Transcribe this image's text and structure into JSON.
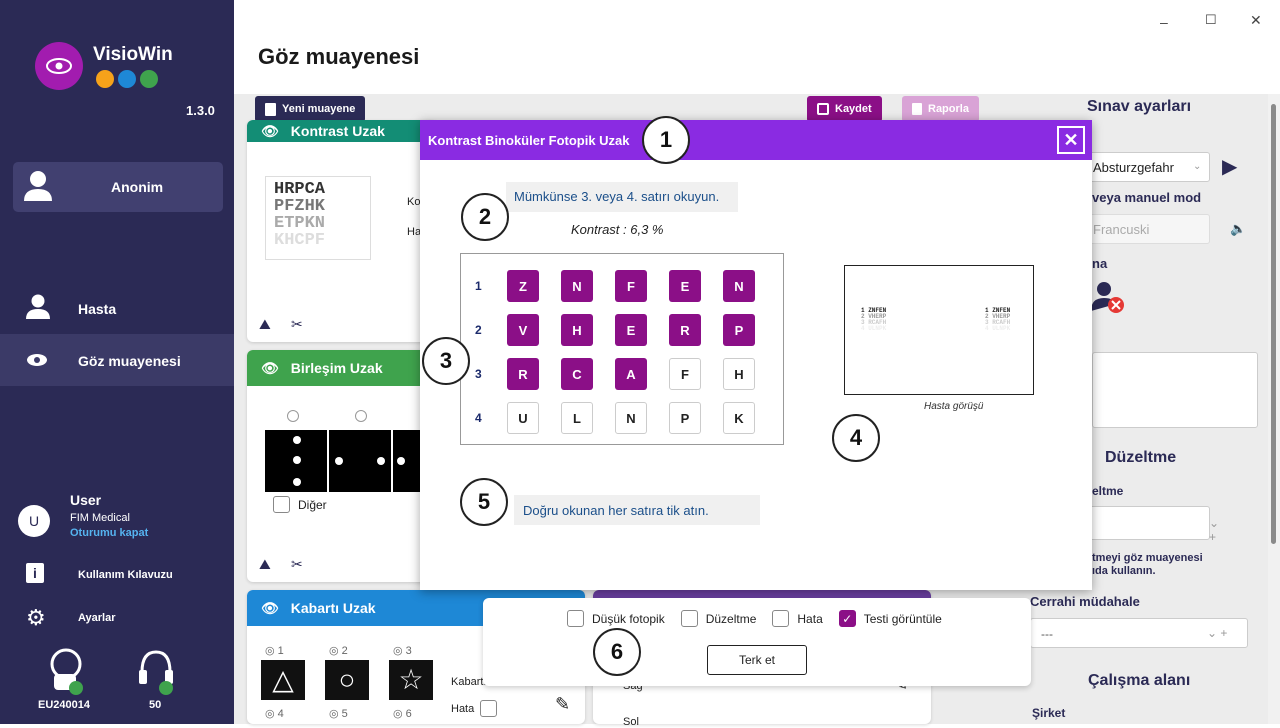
{
  "app": {
    "name": "VisioWin",
    "version": "1.3.0"
  },
  "window": {
    "minimize": "–",
    "maximize": "☐",
    "close": "✕"
  },
  "sidebar": {
    "patient": "Anonim",
    "items": [
      {
        "label": "Hasta"
      },
      {
        "label": "Göz muayenesi"
      }
    ],
    "user": {
      "initial": "U",
      "name": "User",
      "company": "FIM Medical",
      "logout": "Oturumu kapat"
    },
    "manual": "Kullanım Kılavuzu",
    "settings": "Ayarlar",
    "devices": [
      {
        "label": "EU240014"
      },
      {
        "label": "50"
      }
    ]
  },
  "page": {
    "title": "Göz muayenesi"
  },
  "toolbar": {
    "new": "Yeni muayene",
    "save": "Kaydet",
    "report": "Raporla"
  },
  "cards": {
    "contrast": {
      "title": "Kontrast Uzak",
      "chart_rows": [
        "HRPCA",
        "PFZHK",
        "ETPKN",
        "KHCPF"
      ],
      "side_lbl1": "Ko",
      "side_lbl2": "Ha"
    },
    "fusion": {
      "title": "Birleşim Uzak",
      "other": "Diğer"
    },
    "relief": {
      "title": "Kabartı Uzak",
      "opts": [
        "1",
        "2",
        "3"
      ],
      "opts2": [
        "4",
        "5",
        "6"
      ],
      "label": "Kabartı",
      "error": "Hata"
    },
    "bottom_right": {
      "row1": "Sağ",
      "row2": "Sol"
    }
  },
  "settings_panel": {
    "title": "Sınav ayarları",
    "select1": "Absturzgefahr",
    "manual_mode": "veya manuel mod",
    "select2": "Francuski",
    "lbl_na": "na",
    "correction_title": "Düzeltme",
    "correction_lbl": "eltme",
    "note": "tmeyi göz muayenesi\nıda kullanın.",
    "surgery_title": "Cerrahi müdahale",
    "surgery_value": "---",
    "workspace_title": "Çalışma alanı",
    "company_lbl": "Şirket"
  },
  "modal": {
    "title": "Kontrast Binoküler Fotopik Uzak",
    "close": "✕",
    "instruction": "Mümkünse 3. veya 4. satırı okuyun.",
    "contrast": "Kontrast  : 6,3 %",
    "rows": [
      {
        "num": "1",
        "letters": [
          "Z",
          "N",
          "F",
          "E",
          "N"
        ],
        "checked": [
          true,
          true,
          true,
          true,
          true
        ]
      },
      {
        "num": "2",
        "letters": [
          "V",
          "H",
          "E",
          "R",
          "P"
        ],
        "checked": [
          true,
          true,
          true,
          true,
          true
        ]
      },
      {
        "num": "3",
        "letters": [
          "R",
          "C",
          "A",
          "F",
          "H"
        ],
        "checked": [
          true,
          true,
          true,
          false,
          false
        ]
      },
      {
        "num": "4",
        "letters": [
          "U",
          "L",
          "N",
          "P",
          "K"
        ],
        "checked": [
          false,
          false,
          false,
          false,
          false
        ]
      }
    ],
    "patient_view_caption": "Hasta görüşü",
    "preview_rows": [
      "1 ZNFEN",
      "2 VHERP",
      "3 RCAFH",
      "4 ULNPK"
    ],
    "hint": "Doğru okunan her satıra tik atın.",
    "options": [
      {
        "label": "Düşük fotopik",
        "checked": false
      },
      {
        "label": "Düzeltme",
        "checked": false
      },
      {
        "label": "Hata",
        "checked": false
      },
      {
        "label": "Testi görüntüle",
        "checked": true
      }
    ],
    "quit": "Terk et",
    "markers": [
      "1",
      "2",
      "3",
      "4",
      "5",
      "6"
    ]
  },
  "colors": {
    "sidebar": "#2b2a55",
    "accent": "#8a2be2",
    "letter_on": "#8b0f87",
    "teal": "#138d75",
    "green": "#3fa34d",
    "blue": "#1e88d6"
  }
}
